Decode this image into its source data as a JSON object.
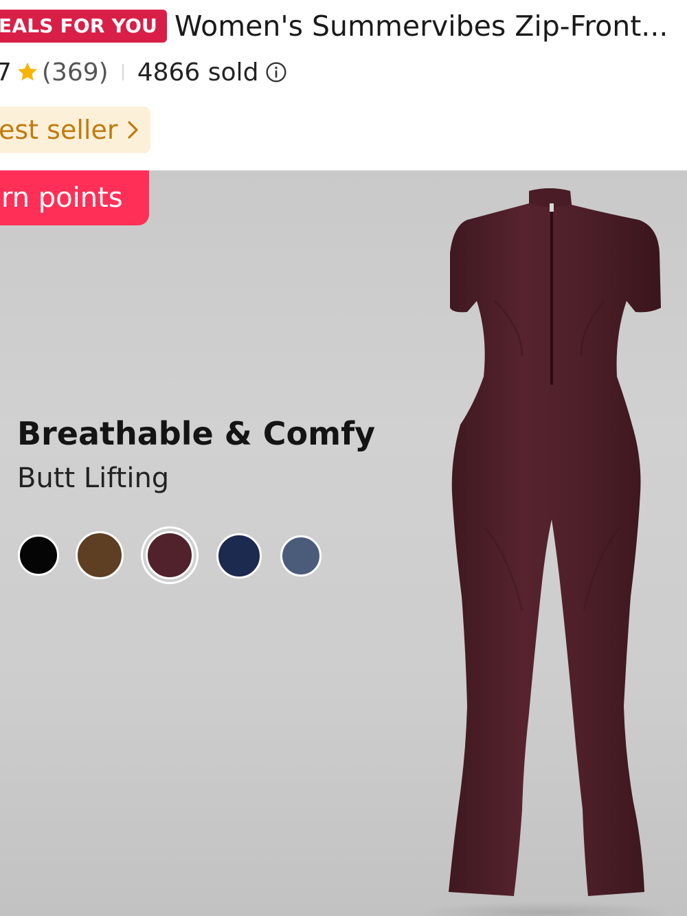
{
  "header": {
    "deals_badge": "EALS FOR YOU",
    "title": "Women's Summervibes Zip-Front...",
    "rating_fragment": "7",
    "review_count": "(369)",
    "sold": "4866 sold",
    "best_seller": "est seller"
  },
  "product_image": {
    "points_badge": "rn points",
    "feature_title": "Breathable & Comfy",
    "feature_subtitle": "Butt Lifting",
    "swatches": [
      {
        "color": "#050505",
        "selected": false
      },
      {
        "color": "#5e3f23",
        "selected": false
      },
      {
        "color": "#51222b",
        "selected": true
      },
      {
        "color": "#1d2a50",
        "selected": false
      },
      {
        "color": "#4b5c7b",
        "selected": false
      }
    ],
    "garment_color": "#4d1f29"
  },
  "colors": {
    "deals_red": "#d91f47",
    "points_red": "#ff2f57",
    "star_yellow": "#f7b500",
    "best_seller_bg": "#fdf0d8",
    "best_seller_text": "#c07b0f"
  },
  "icons": {
    "rating": "star-icon",
    "sold_info": "info-icon",
    "best_seller_link": "chevron-right-icon"
  }
}
